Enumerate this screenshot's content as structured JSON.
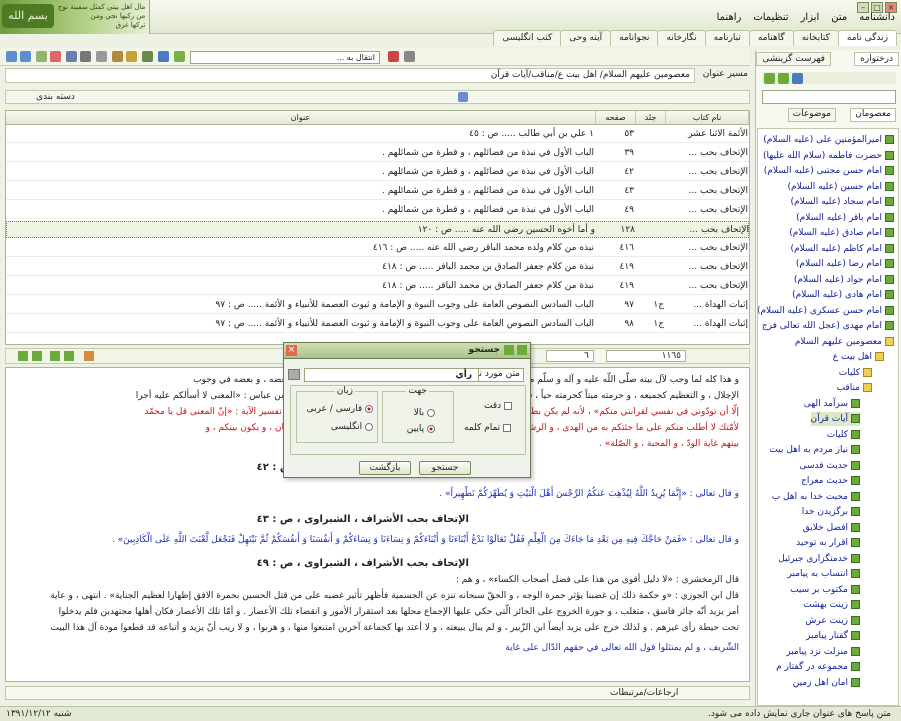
{
  "banner": {
    "calligraphy": "بسم الله",
    "line1": "مال اهل بيتي كمثل سفينة نوح",
    "line2": "من ركبها نجي ومن",
    "line3": "تركها غرق"
  },
  "menu": [
    "دانشنامه",
    "متن",
    "ابزار",
    "تنظیمات",
    "راهنما"
  ],
  "top_tabs": [
    "زندگی نامه",
    "کتابخانه",
    "گاهنامه",
    "تبارنامه",
    "نگارخانه",
    "نجوانامه",
    "آینه وحی",
    "کتب انگلیسی"
  ],
  "right_tabs": {
    "tab1": "درختواره",
    "tab2": "فهرست گزینشی"
  },
  "toolbar": {
    "nav_combo": "انتقال به ..."
  },
  "path": {
    "label": "مسیر عنوان",
    "value": "معصومین علیهم السلام/ اهل بیت ع/مناقب/آیات قرآن"
  },
  "filter": {
    "label": "دسته بندی"
  },
  "side_tabs": {
    "masoomin": "معصومان",
    "mowzuat": "موضوعات"
  },
  "tree": [
    {
      "label": "امیرالمؤمنین علی (علیه السلام)",
      "type": "leaf"
    },
    {
      "label": "حضرت فاطمه (سلام الله علیها)",
      "type": "leaf"
    },
    {
      "label": "امام حسن مجتبی (علیه السلام)",
      "type": "leaf"
    },
    {
      "label": "امام حسین (علیه السلام)",
      "type": "leaf"
    },
    {
      "label": "امام سجاد (علیه السلام)",
      "type": "leaf"
    },
    {
      "label": "امام باقر (علیه السلام)",
      "type": "leaf"
    },
    {
      "label": "امام صادق (علیه السلام)",
      "type": "leaf"
    },
    {
      "label": "امام کاظم (علیه السلام)",
      "type": "leaf"
    },
    {
      "label": "امام رضا (علیه السلام)",
      "type": "leaf"
    },
    {
      "label": "امام جواد (علیه السلام)",
      "type": "leaf"
    },
    {
      "label": "امام هادی (علیه السلام)",
      "type": "leaf"
    },
    {
      "label": "امام حسن عسکری (علیه السلام)",
      "type": "leaf"
    },
    {
      "label": "امام مهدی (عجل الله تعالی فرج",
      "type": "leaf"
    },
    {
      "label": "معصومین علیهم السلام",
      "type": "folder"
    },
    {
      "label": "اهل بیت ع",
      "type": "folder"
    },
    {
      "label": "کلیات",
      "type": "folder"
    },
    {
      "label": "مناقب",
      "type": "folder"
    },
    {
      "label": "سرآمد الهی",
      "type": "leaf"
    },
    {
      "label": "آیات قرآن",
      "type": "leaf",
      "selected": true
    },
    {
      "label": "کلیات",
      "type": "leaf"
    },
    {
      "label": "نیاز مردم به اهل بیت",
      "type": "leaf"
    },
    {
      "label": "حدیث قدسی",
      "type": "leaf"
    },
    {
      "label": "حدیث معراج",
      "type": "leaf"
    },
    {
      "label": "محبت خدا به اهل ب",
      "type": "leaf"
    },
    {
      "label": "برگزیدن خدا",
      "type": "leaf"
    },
    {
      "label": "افضل خلایق",
      "type": "leaf"
    },
    {
      "label": "اقرار به توحید",
      "type": "leaf"
    },
    {
      "label": "خدمتگزاری جبرئیل",
      "type": "leaf"
    },
    {
      "label": "انتساب به پیامبر",
      "type": "leaf"
    },
    {
      "label": "مکتوب بر سیب",
      "type": "leaf"
    },
    {
      "label": "زینت بهشت",
      "type": "leaf"
    },
    {
      "label": "زینت عرش",
      "type": "leaf"
    },
    {
      "label": "گفتار پیامبر",
      "type": "leaf"
    },
    {
      "label": "منزلت نزد پیامبر",
      "type": "leaf"
    },
    {
      "label": "مجموعه در گفتار م",
      "type": "leaf"
    },
    {
      "label": "امان اهل زمین",
      "type": "leaf"
    }
  ],
  "grid": {
    "headers": {
      "title": "عنوان",
      "page": "صفحه",
      "volume": "جلد",
      "book": "نام کتاب"
    },
    "rows": [
      {
        "book": "الأئمة الاثنا عشر",
        "volume": "",
        "page": "٥٣",
        "title": "١ علي بن أبي طالب ..... ص : ٤٥",
        "selected": false
      },
      {
        "book": "الإتحاف بحب ...",
        "volume": "",
        "page": "٣٩",
        "title": "الباب الأول في نبذة من فضائلهم ، و قطرة من شمائلهم .",
        "selected": false
      },
      {
        "book": "الإتحاف بحب ...",
        "volume": "",
        "page": "٤٢",
        "title": "الباب الأول في نبذة من فضائلهم ، و قطرة من شمائلهم .",
        "selected": false
      },
      {
        "book": "الإتحاف بحب ...",
        "volume": "",
        "page": "٤٣",
        "title": "الباب الأول في نبذة من فضائلهم ، و قطرة من شمائلهم .",
        "selected": false
      },
      {
        "book": "الإتحاف بحب ...",
        "volume": "",
        "page": "٤٩",
        "title": "الباب الأول في نبذة من فضائلهم ، و قطرة من شمائلهم .",
        "selected": false
      },
      {
        "book": "الإتحاف بحب ...",
        "volume": "",
        "page": "١٢٨",
        "title": "و أما أخوه الحسين رضي الله عنه ..... ص : ١٢٠",
        "selected": true
      },
      {
        "book": "الإتحاف بحب ...",
        "volume": "",
        "page": "٤١٦",
        "title": "نبذه من كلام ولده محمد الباقر رضي الله عنه ..... ص : ٤١٦",
        "selected": false
      },
      {
        "book": "الإتحاف بحب ...",
        "volume": "",
        "page": "٤١٩",
        "title": "نبذة من كلام جعفر الصادق بن محمد الباقر ..... ص : ٤١٨",
        "selected": false
      },
      {
        "book": "الإتحاف بحب ...",
        "volume": "",
        "page": "٤١٩",
        "title": "نبذة من كلام جعفر الصادق بن محمد الباقر ..... ص : ٤١٨",
        "selected": false
      },
      {
        "book": "إثبات الهداة ...",
        "volume": "ج١",
        "page": "٩٧",
        "title": "الباب السادس النصوص العامة على وجوب النبوة و الإمامة و ثبوت العصمة للأنبياء و الأئمة ..... ص : ٩٧",
        "selected": false
      },
      {
        "book": "إثبات الهداة ...",
        "volume": "ج١",
        "page": "٩٨",
        "title": "الباب السادس النصوص العامة على وجوب النبوة و الإمامة و ثبوت العصمة للأنبياء و الأئمة ..... ص : ٩٧",
        "selected": false
      }
    ]
  },
  "counts": {
    "total": "١١٦٥",
    "current": "٦"
  },
  "text_lines": [
    {
      "text": "و هذا كله لما وجب لآل بيته صلّى اللّه عليه و آله و سلّم من المحبة و الإجلال ، و سريان لحمه ، و دمه الكريمين فيهم ، فهم بعضه ، و بعضه في وجوب",
      "cls": ""
    },
    {
      "text": "الإجلال ، و التعظيم كجميعه ، و حرمته ميتاً كحرمته حياً ، قال تعالى : «قُل لاَّ أَسْأَلُكُمْ عَلَيْهِ أَجْراً إِلاَّ الْمَوَدَّةَ فِي الْقُرْبَى» ، قال ابن عباس : «المعنى لا أسألكم عليه أجرا",
      "cls": ""
    },
    {
      "text": "إلّا أن تودّوني في نفسي لقرابتي منكم» ، لأنه لم يكن بطن من قريش إلّا و بينه و بينهم قرابة ، لكن الأنسب ما قاله غيره في تفسير الآية : «إنّ المعنى قل يا محمّد",
      "cls": "red"
    },
    {
      "text": "لأمّتك لا أطلب منكم على ما جئتكم به من الهدى ، و الرشاد إلا أن تحبوا قرابتي ، و تحبوهم ، و تعاملوهم بالمعروف ، و الإحسان ، و يكون بينكم ، و",
      "cls": "red"
    },
    {
      "text": "بينهم غاية الودّ ، و المحبة ، و الصّلة» .",
      "cls": "red"
    },
    {
      "text": "الإتحاف بحب الأشراف ، الشبراوى ، ص : ٤٢",
      "cls": "hd"
    },
    {
      "text": "و قال تعالى : «إِنَّمَا يُرِيدُ اللَّهُ لِيُذْهِبَ عَنكُمُ الرِّجْسَ أَهْلَ الْبَيْتِ وَ يُطَهِّرَكُمْ تَطْهِيراً» .",
      "cls": "blue"
    },
    {
      "text": "الإتحاف بحب الأشراف ، الشبراوى ، ص : ٤٣",
      "cls": "hd"
    },
    {
      "text": "و قال تعالى : «فَمَنْ حَاجَّكَ فِيهِ مِن بَعْدِ مَا جَاءَكَ مِنَ الْعِلْمِ فَقُلْ تَعَالَوْا نَدْعُ أَبْنَاءَنَا وَ أَبْنَاءَكُمْ وَ نِسَاءَنَا وَ نِسَاءَكُمْ وَ أَنفُسَنَا وَ أَنفُسَكُمْ ثُمَّ نَبْتَهِلْ فَنَجْعَل لَّعْنَتَ اللَّهِ عَلَى الْكَاذِبِينَ» .",
      "cls": "blue"
    },
    {
      "text": "الإتحاف بحب الأشراف ، الشبراوى ، ص : ٤٩",
      "cls": "hd"
    },
    {
      "text": "قال الزمخشري : «لا دليل أقوى من هذا على فضل أصحاب الكساء» ، و هم :",
      "cls": ""
    },
    {
      "text": "قال ابن الجوزي : «و حكمة ذلك إن غضبنا يؤثر حمرة الوجه ، و الحقّ سبحانه تنزه عن الجسمية فأظهر تأثير غضبه على من قتل الحسين بحمرة الافق إظهارا لعظيم الجناية» . انتهى ، و عاية",
      "cls": ""
    },
    {
      "text": "أمر يزيد أنّه جائر فاسق ، متغلب ، و جورة الخروج على الجائر الّتي حكي عليها الإجماع محلها بعد استقرار الأمور و انقضاء تلك الأعصار . و أمّا تلك الأعصار فكان أهلها مجتهدين فلم يدخلوا",
      "cls": ""
    },
    {
      "text": "تحت حيطة رأي غيرهم . و لذلك خرج على يزيد أيضاً ابن الزّبير ، و لم يبال ببيعته ، و لا أعتد بها كجماعة آخرين امتنعوا منها ، و هربوا ، و لا ريب أنّ يزيد و أتباعه قد قطعوا مودة آل هذا البيت",
      "cls": ""
    },
    {
      "text": "الشّريف ، و لم يمتثلوا قول الله تعالى في حقهم الدّال على غاية",
      "cls": "blue"
    }
  ],
  "dialog": {
    "title": "جستجو",
    "field_label": "متن مورد نظر",
    "field_value": "رأي",
    "group_lang": "زبان",
    "group_dir": "جهت",
    "lang_fa": "فارسی / عربی",
    "lang_en": "انگلیسی",
    "dir_up": "بالا",
    "dir_down": "پایین",
    "chk_exact": "دقت",
    "chk_word": "تمام کلمه",
    "btn_search": "جستجو",
    "btn_back": "بازگشت"
  },
  "bottom": {
    "label": "ارجاعات/مرتبطات"
  },
  "status": {
    "date": "شنبه ١٣٩١/١٢/١٢",
    "message": "متن پاسخ های عنوان جاری نمایش داده می شود."
  },
  "colors": {
    "accent": "#6cab3a",
    "quran": "#1f2cb8",
    "hadith": "#c4121c",
    "highlight": "#138a2c"
  }
}
